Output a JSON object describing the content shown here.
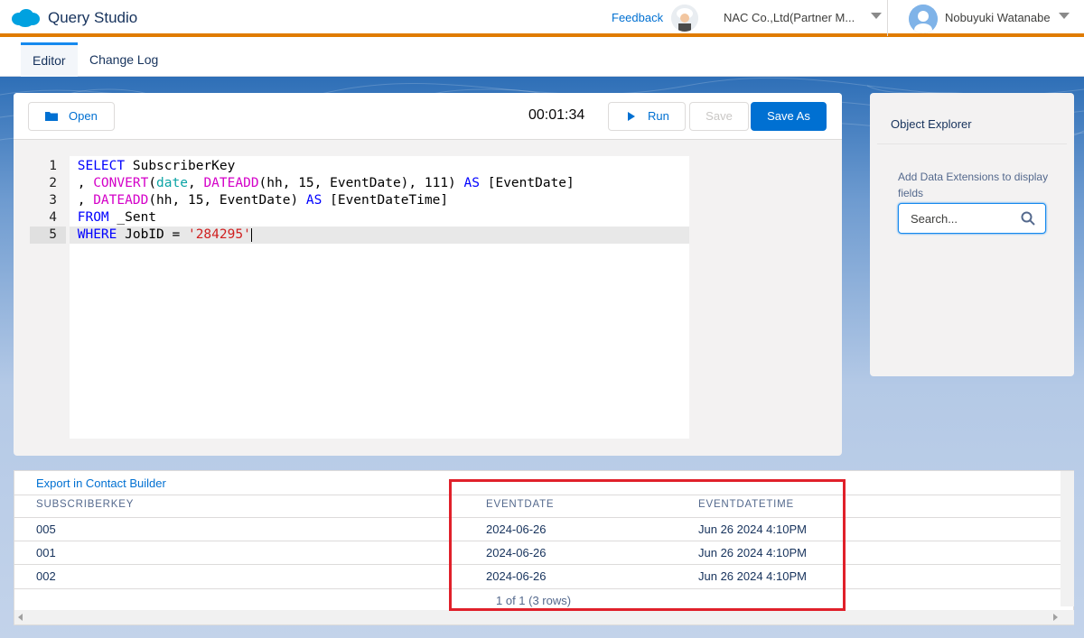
{
  "header": {
    "app_title": "Query Studio",
    "feedback_label": "Feedback",
    "org_name": "NAC Co.,Ltd(Partner M...",
    "user_name": "Nobuyuki Watanabe",
    "brand_color": "#00a1e0",
    "accent_color": "#e07b00"
  },
  "tabs": [
    "Editor",
    "Change Log"
  ],
  "editor": {
    "open_label": "Open",
    "timer": "00:01:34",
    "run_label": "Run",
    "save_label": "Save",
    "save_as_label": "Save As",
    "line_numbers": [
      "1",
      "2",
      "3",
      "4",
      "5"
    ],
    "code_lines": [
      "SELECT SubscriberKey",
      ", CONVERT(date, DATEADD(hh, 15, EventDate), 111) AS [EventDate]",
      ", DATEADD(hh, 15, EventDate) AS [EventDateTime]",
      "FROM _Sent",
      "WHERE JobID = '284295'"
    ]
  },
  "explorer": {
    "title": "Object Explorer",
    "hint": "Add Data Extensions to display fields",
    "search_placeholder": "Search..."
  },
  "results": {
    "export_label": "Export in Contact Builder",
    "columns": [
      "SUBSCRIBERKEY",
      "EVENTDATE",
      "EVENTDATETIME"
    ],
    "rows": [
      [
        "005",
        "2024-06-26",
        "Jun 26 2024 4:10PM"
      ],
      [
        "001",
        "2024-06-26",
        "Jun 26 2024 4:10PM"
      ],
      [
        "002",
        "2024-06-26",
        "Jun 26 2024 4:10PM"
      ]
    ],
    "pager": "1 of 1 (3 rows)"
  },
  "icons": {
    "logo": "salesforce-cloud-icon",
    "open": "folder-icon",
    "run": "play-icon",
    "search": "search-icon"
  }
}
